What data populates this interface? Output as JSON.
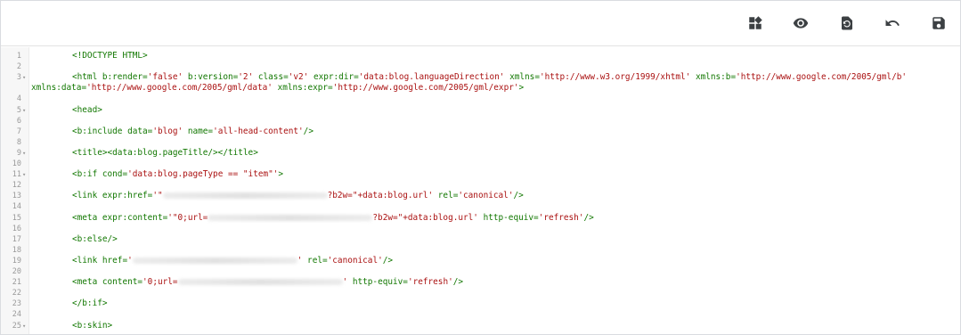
{
  "toolbar": {
    "buttons": [
      {
        "name": "widgets-icon",
        "label": "Jump to widget"
      },
      {
        "name": "eye-icon",
        "label": "Preview"
      },
      {
        "name": "restore-icon",
        "label": "Restore"
      },
      {
        "name": "undo-icon",
        "label": "Undo"
      },
      {
        "name": "save-icon",
        "label": "Save"
      }
    ]
  },
  "editor": {
    "lines": [
      {
        "n": "1",
        "fold": false,
        "segs": [
          {
            "t": "<!DOCTYPE HTML>"
          }
        ]
      },
      {
        "n": "2",
        "fold": false,
        "segs": []
      },
      {
        "n": "3",
        "fold": true,
        "segs": [
          {
            "t": "<html b:render="
          },
          {
            "t": "'false'",
            "c": "str"
          },
          {
            "t": " b:version="
          },
          {
            "t": "'2'",
            "c": "str"
          },
          {
            "t": " class="
          },
          {
            "t": "'v2'",
            "c": "str"
          },
          {
            "t": " expr:dir="
          },
          {
            "t": "'data:blog.languageDirection'",
            "c": "str"
          },
          {
            "t": " xmlns="
          },
          {
            "t": "'http://www.w3.org/1999/xhtml'",
            "c": "str"
          },
          {
            "t": " xmlns:b="
          },
          {
            "t": "'http://www.google.com/2005/gml/b'",
            "c": "str"
          }
        ]
      },
      {
        "n": "",
        "fold": false,
        "wrap": true,
        "segs": [
          {
            "t": "xmlns:data="
          },
          {
            "t": "'http://www.google.com/2005/gml/data'",
            "c": "str"
          },
          {
            "t": " xmlns:expr="
          },
          {
            "t": "'http://www.google.com/2005/gml/expr'",
            "c": "str"
          },
          {
            "t": ">"
          }
        ]
      },
      {
        "n": "4",
        "fold": false,
        "segs": []
      },
      {
        "n": "5",
        "fold": true,
        "segs": [
          {
            "t": "<head>"
          }
        ]
      },
      {
        "n": "6",
        "fold": false,
        "segs": []
      },
      {
        "n": "7",
        "fold": false,
        "segs": [
          {
            "t": "<b:include data="
          },
          {
            "t": "'blog'",
            "c": "str"
          },
          {
            "t": " name="
          },
          {
            "t": "'all-head-content'",
            "c": "str"
          },
          {
            "t": "/>"
          }
        ]
      },
      {
        "n": "8",
        "fold": false,
        "segs": []
      },
      {
        "n": "9",
        "fold": true,
        "segs": [
          {
            "t": "<title><data:blog.pageTitle/></title>"
          }
        ]
      },
      {
        "n": "10",
        "fold": false,
        "segs": []
      },
      {
        "n": "11",
        "fold": true,
        "segs": [
          {
            "t": "<b:if cond="
          },
          {
            "t": "'data:blog.pageType == \"item\"'",
            "c": "str"
          },
          {
            "t": ">"
          }
        ]
      },
      {
        "n": "12",
        "fold": false,
        "segs": []
      },
      {
        "n": "13",
        "fold": false,
        "segs": [
          {
            "t": "<link expr:href="
          },
          {
            "t": "'\"",
            "c": "str"
          },
          {
            "blur": 185
          },
          {
            "t": "?b2w=\"+data:blog.url'",
            "c": "str"
          },
          {
            "t": " rel="
          },
          {
            "t": "'canonical'",
            "c": "str"
          },
          {
            "t": "/>"
          }
        ]
      },
      {
        "n": "14",
        "fold": false,
        "segs": []
      },
      {
        "n": "15",
        "fold": false,
        "segs": [
          {
            "t": "<meta expr:content="
          },
          {
            "t": "'\"0;url=",
            "c": "str"
          },
          {
            "blur": 185
          },
          {
            "t": "?b2w=\"+data:blog.url'",
            "c": "str"
          },
          {
            "t": " http-equiv="
          },
          {
            "t": "'refresh'",
            "c": "str"
          },
          {
            "t": "/>"
          }
        ]
      },
      {
        "n": "16",
        "fold": false,
        "segs": []
      },
      {
        "n": "17",
        "fold": false,
        "segs": [
          {
            "t": "<b:else/>"
          }
        ]
      },
      {
        "n": "18",
        "fold": false,
        "segs": []
      },
      {
        "n": "19",
        "fold": false,
        "segs": [
          {
            "t": "<link href="
          },
          {
            "t": "'",
            "c": "str"
          },
          {
            "blur": 185
          },
          {
            "t": "'",
            "c": "str"
          },
          {
            "t": " rel="
          },
          {
            "t": "'canonical'",
            "c": "str"
          },
          {
            "t": "/>"
          }
        ]
      },
      {
        "n": "20",
        "fold": false,
        "segs": []
      },
      {
        "n": "21",
        "fold": false,
        "segs": [
          {
            "t": "<meta content="
          },
          {
            "t": "'0;url=",
            "c": "str"
          },
          {
            "blur": 185
          },
          {
            "t": "'",
            "c": "str"
          },
          {
            "t": " http-equiv="
          },
          {
            "t": "'refresh'",
            "c": "str"
          },
          {
            "t": "/>"
          }
        ]
      },
      {
        "n": "22",
        "fold": false,
        "segs": []
      },
      {
        "n": "23",
        "fold": false,
        "segs": [
          {
            "t": "</b:if>"
          }
        ]
      },
      {
        "n": "24",
        "fold": false,
        "segs": []
      },
      {
        "n": "25",
        "fold": true,
        "segs": [
          {
            "t": "<b:skin>"
          }
        ]
      }
    ]
  }
}
